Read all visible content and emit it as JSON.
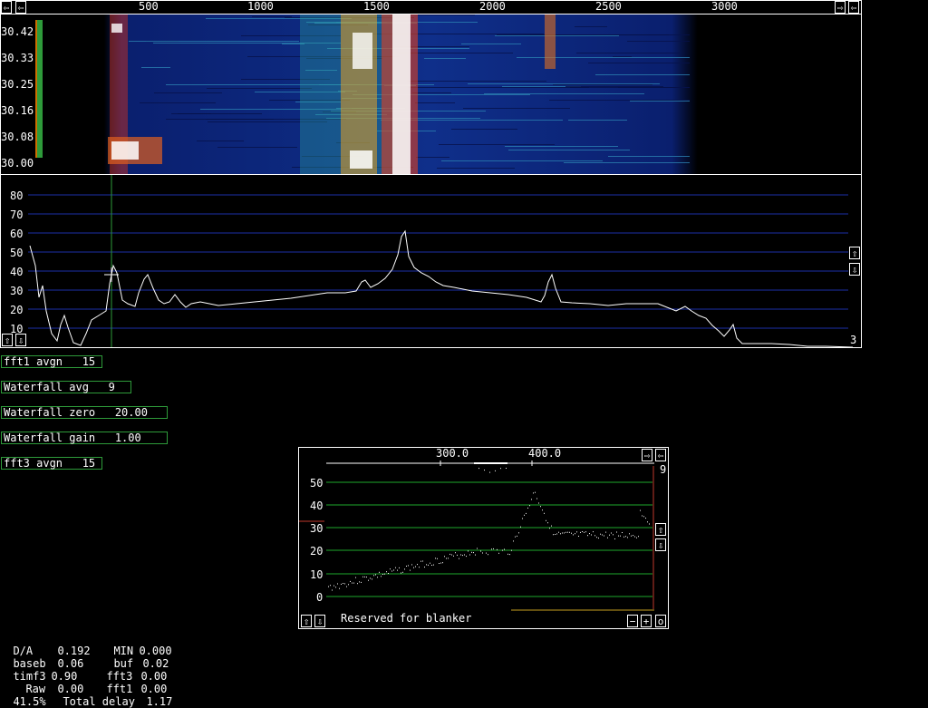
{
  "waterfall": {
    "freq_ticks": [
      "500",
      "1000",
      "1500",
      "2000",
      "2500",
      "3000"
    ],
    "time_ticks": [
      "30.42",
      "30.33",
      "30.25",
      "30.16",
      "30.08",
      "30.00"
    ]
  },
  "spectrum": {
    "y_ticks": [
      "80",
      "70",
      "60",
      "50",
      "40",
      "30",
      "20",
      "10"
    ],
    "avg_count": "3"
  },
  "params": {
    "fft1_avgn": "fft1 avgn   15",
    "waterfall_avg": "Waterfall avg   9",
    "waterfall_zero": "Waterfall zero   20.00",
    "waterfall_gain": "Waterfall gain   1.00",
    "fft3_avgn": "fft3 avgn   15"
  },
  "baseband": {
    "freq_ticks": [
      "300.0",
      "400.0"
    ],
    "y_ticks": [
      "50",
      "40",
      "30",
      "20",
      "10",
      "0"
    ],
    "right_label": "9",
    "blanker_label": "Reserved for blanker",
    "minus_label": "−",
    "plus_label": "+",
    "o_label": "o"
  },
  "status": {
    "da_label": "D/A",
    "da_value": "0.192",
    "min_label": "MIN",
    "min_value": "0.000",
    "baseb_label": "baseb",
    "baseb_value": "0.06",
    "buf_label": "buf",
    "buf_value": "0.02",
    "timf3_label": "timf3",
    "timf3_value": "0.90",
    "fft3_label": "fft3",
    "fft3_value": "0.00",
    "raw_label": "Raw",
    "raw_value": "0.00",
    "fft1_label": "fft1",
    "fft1_value": "0.00",
    "cpu_pct": "41.5%",
    "delay_label": "Total delay",
    "delay_value": "1.17"
  },
  "icons": {
    "left_arrow": "⇦",
    "right_arrow": "⇨",
    "up_arrow": "⇧",
    "down_arrow": "⇩"
  },
  "colors": {
    "grid_blue": "#1c2fa8",
    "green_border": "#2e9b3a",
    "baseband_grid": "#1ea82b",
    "red_axis": "#c0392b"
  }
}
